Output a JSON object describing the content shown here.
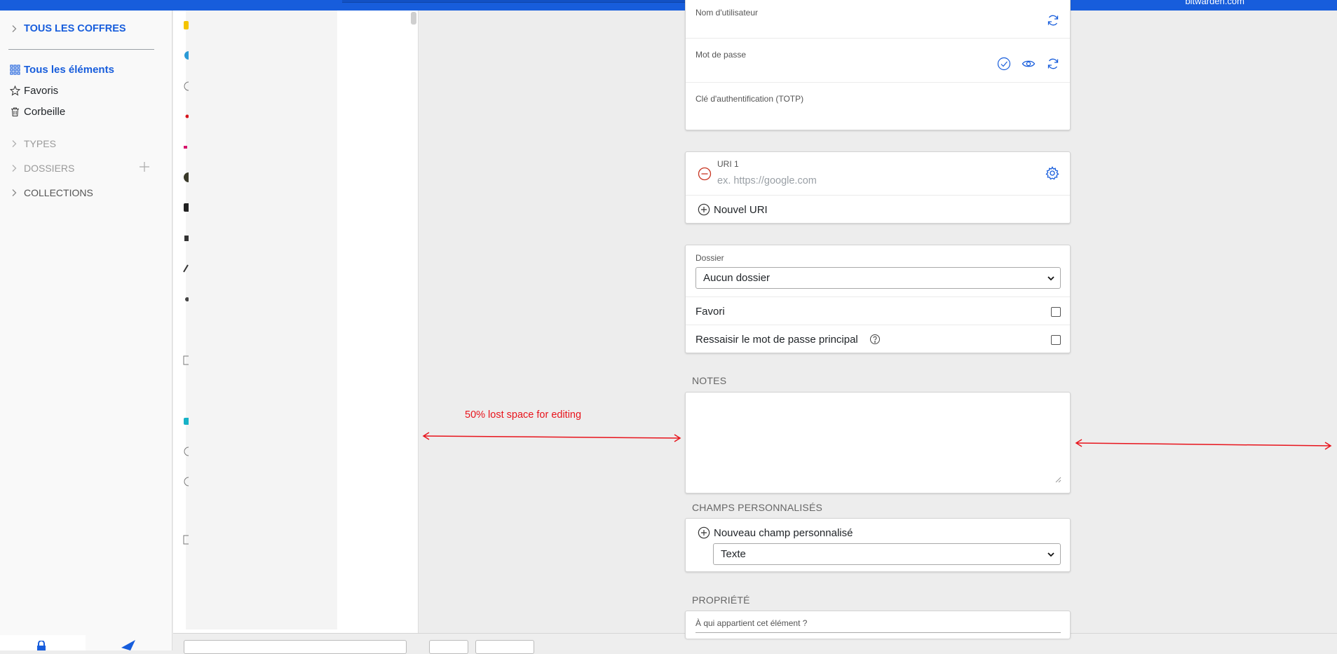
{
  "header": {
    "brand": "bitwarden.com"
  },
  "sidebar": {
    "vaults_label": "TOUS LES COFFRES",
    "all_items_label": "Tous les éléments",
    "favorites_label": "Favoris",
    "trash_label": "Corbeille",
    "types_label": "TYPES",
    "folders_label": "DOSSIERS",
    "collections_label": "COLLECTIONS"
  },
  "form": {
    "login": {
      "username_label": "Nom d'utilisateur",
      "password_label": "Mot de passe",
      "totp_label": "Clé d'authentification (TOTP)"
    },
    "uri": {
      "label": "URI 1",
      "placeholder": "ex. https://google.com",
      "new_uri_label": "Nouvel URI"
    },
    "options": {
      "folder_label": "Dossier",
      "folder_value": "Aucun dossier",
      "favorite_label": "Favori",
      "reprompt_label": "Ressaisir le mot de passe principal"
    },
    "notes": {
      "title": "NOTES"
    },
    "custom_fields": {
      "title": "CHAMPS PERSONNALISÉS",
      "new_field_label": "Nouveau champ personnalisé",
      "type_value": "Texte"
    },
    "ownership": {
      "title": "PROPRIÉTÉ",
      "question": "À qui appartient cet élément ?"
    }
  },
  "annotation": {
    "text": "50% lost space for editing",
    "color": "#e8141c"
  },
  "colors": {
    "accent": "#175ddc",
    "danger": "#c83522",
    "background": "#ededed"
  }
}
